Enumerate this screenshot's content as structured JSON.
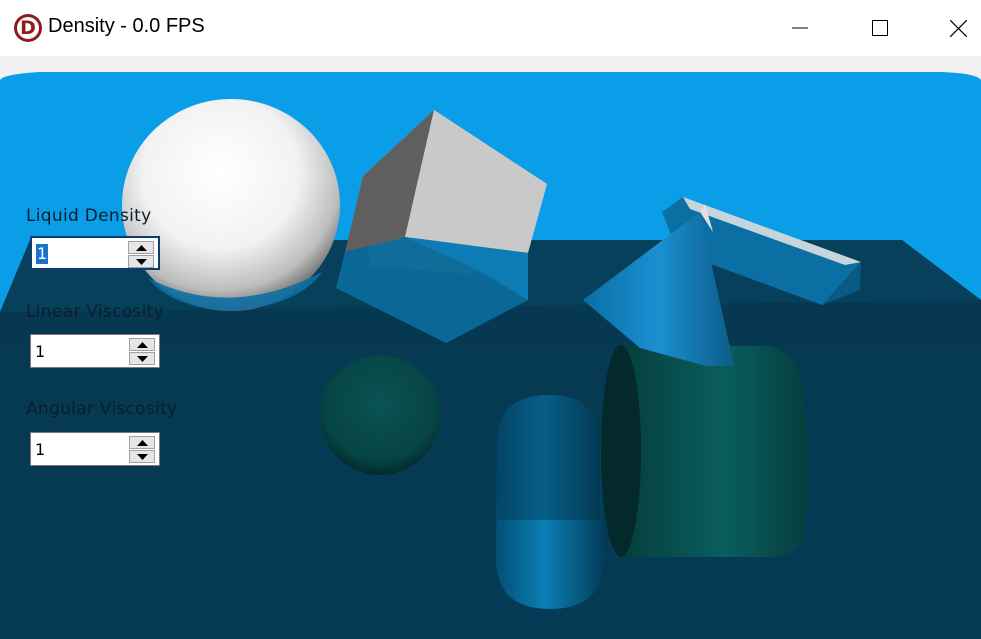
{
  "window": {
    "title": "Density - 0.0 FPS",
    "icon_letter": "D",
    "app_icon": "app-logo-icon",
    "controls": [
      "minimize-icon",
      "maximize-icon",
      "close-icon"
    ]
  },
  "panel": {
    "liquid_density": {
      "label": "Liquid Density",
      "value": "1"
    },
    "linear_viscosity": {
      "label": "Linear Viscosity",
      "value": "1"
    },
    "angular_viscosity": {
      "label": "Angular Viscosity",
      "value": "1"
    }
  },
  "colors": {
    "sky": "#0a9ee8",
    "liquid": "#053a52",
    "accent": "#1a73c9"
  }
}
